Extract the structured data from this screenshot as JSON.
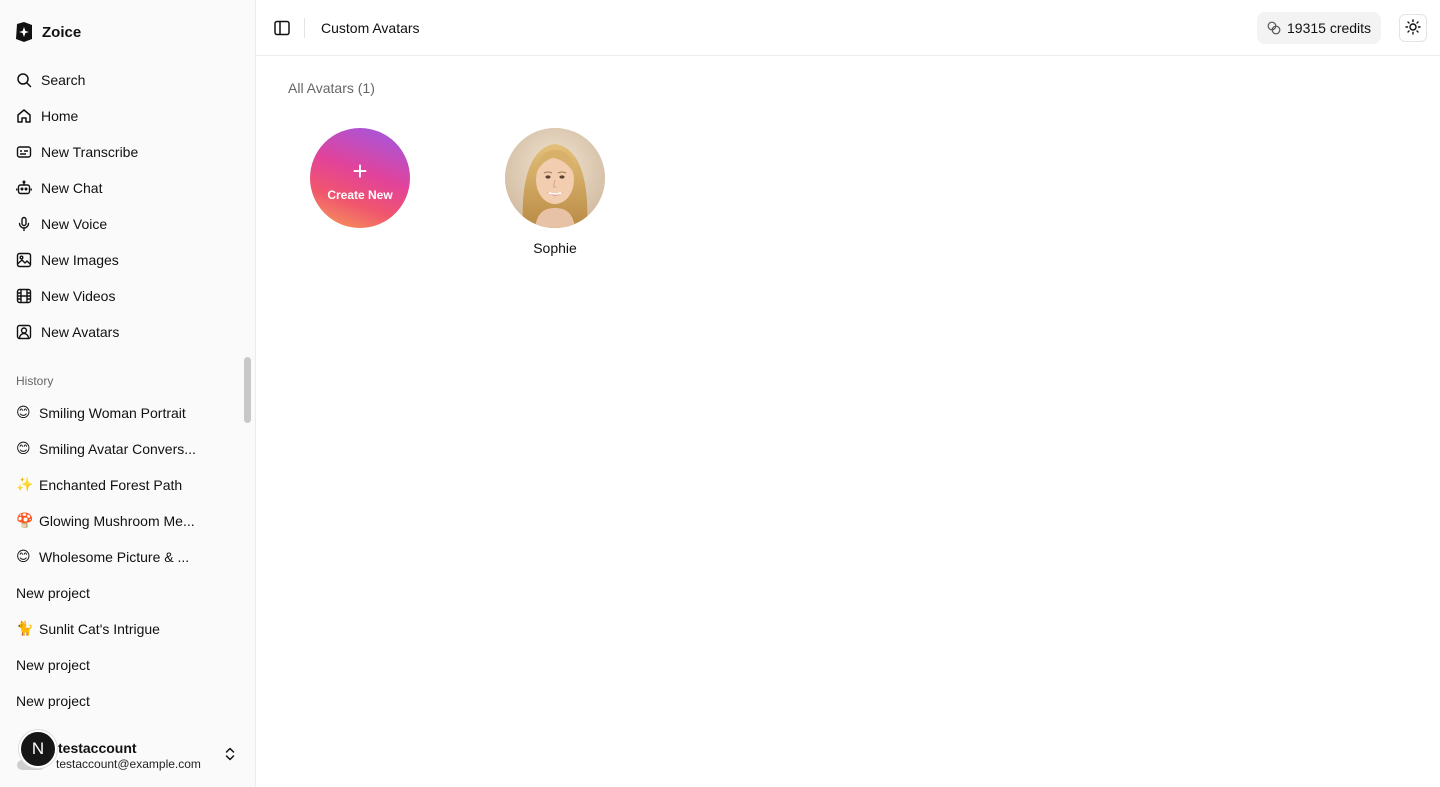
{
  "brand": {
    "name": "Zoice"
  },
  "nav": [
    {
      "label": "Search",
      "icon": "search-icon"
    },
    {
      "label": "Home",
      "icon": "home-icon"
    },
    {
      "label": "New Transcribe",
      "icon": "transcribe-icon"
    },
    {
      "label": "New Chat",
      "icon": "bot-icon"
    },
    {
      "label": "New Voice",
      "icon": "mic-icon"
    },
    {
      "label": "New Images",
      "icon": "image-icon"
    },
    {
      "label": "New Videos",
      "icon": "film-icon"
    },
    {
      "label": "New Avatars",
      "icon": "avatar-icon"
    }
  ],
  "history": {
    "title": "History",
    "items": [
      {
        "emoji": "😊",
        "label": "Smiling Woman Portrait"
      },
      {
        "emoji": "😊",
        "label": "Smiling Avatar Convers..."
      },
      {
        "emoji": "✨",
        "label": "Enchanted Forest Path"
      },
      {
        "emoji": "🍄",
        "label": "Glowing Mushroom Me..."
      },
      {
        "emoji": "😊",
        "label": "Wholesome Picture & ..."
      },
      {
        "emoji": "",
        "label": "New project"
      },
      {
        "emoji": "🐈",
        "label": "Sunlit Cat's Intrigue"
      },
      {
        "emoji": "",
        "label": "New project"
      },
      {
        "emoji": "",
        "label": "New project"
      }
    ]
  },
  "user": {
    "initial": "N",
    "name": "testaccount",
    "email": "testaccount@example.com"
  },
  "topbar": {
    "title": "Custom Avatars",
    "credits": "19315 credits"
  },
  "main": {
    "section_title": "All Avatars (1)",
    "create_label": "Create New",
    "create_plus": "+",
    "avatars": [
      {
        "name": "Sophie"
      }
    ]
  },
  "colors": {
    "accent_gradient_start": "#9b59e8",
    "accent_gradient_mid": "#e2439a",
    "accent_gradient_end": "#f7a056"
  }
}
